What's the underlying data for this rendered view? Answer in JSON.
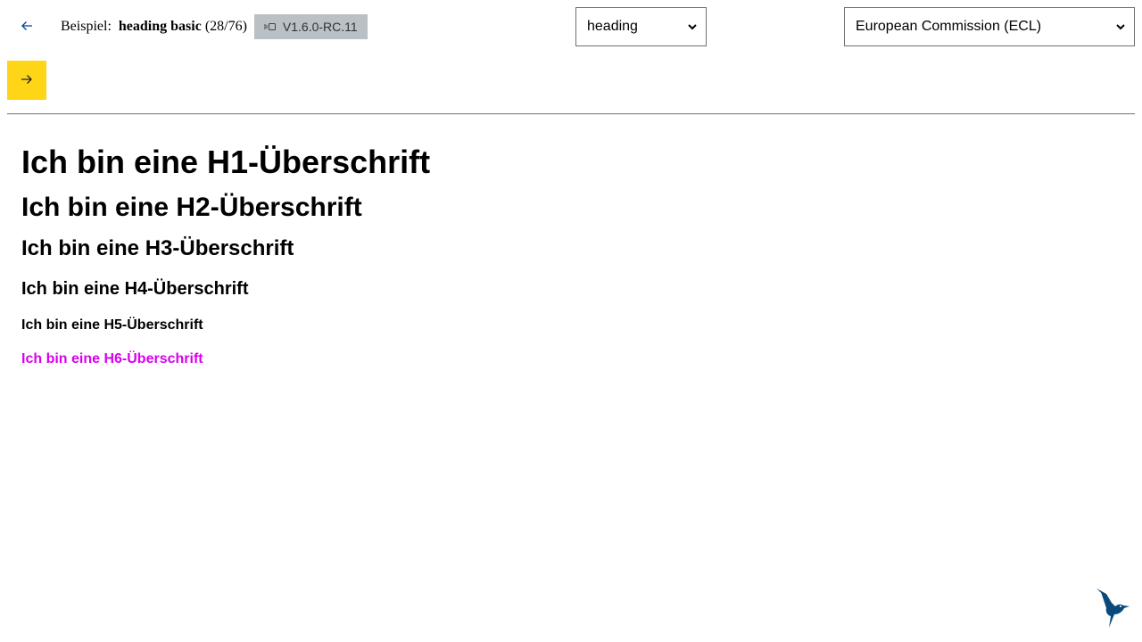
{
  "toolbar": {
    "back_icon": "arrow-left-icon",
    "example_prefix": "Beispiel:",
    "example_name": "heading basic",
    "example_counter": "(28/76)",
    "version_icon": "switch-icon",
    "version": "V1.6.0-RC.11",
    "component_select": {
      "value": "heading",
      "icon": "chevron-down-icon"
    },
    "theme_select": {
      "value": "European Commission (ECL)",
      "icon": "chevron-down-icon"
    },
    "next_icon": "arrow-right-icon"
  },
  "headings": {
    "h1": "Ich bin eine H1-Überschrift",
    "h2": "Ich bin eine H2-Überschrift",
    "h3": "Ich bin eine H3-Überschrift",
    "h4": "Ich bin eine H4-Überschrift",
    "h5": "Ich bin eine H5-Überschrift",
    "h6": "Ich bin eine H6-Überschrift"
  },
  "colors": {
    "accent_blue": "#004494",
    "next_button": "#ffd617",
    "version_badge": "#b9c0c6",
    "h6_text": "#d900f0",
    "logo": "#0a4a7a"
  },
  "footer": {
    "logo_icon": "hummingbird-logo-icon"
  }
}
